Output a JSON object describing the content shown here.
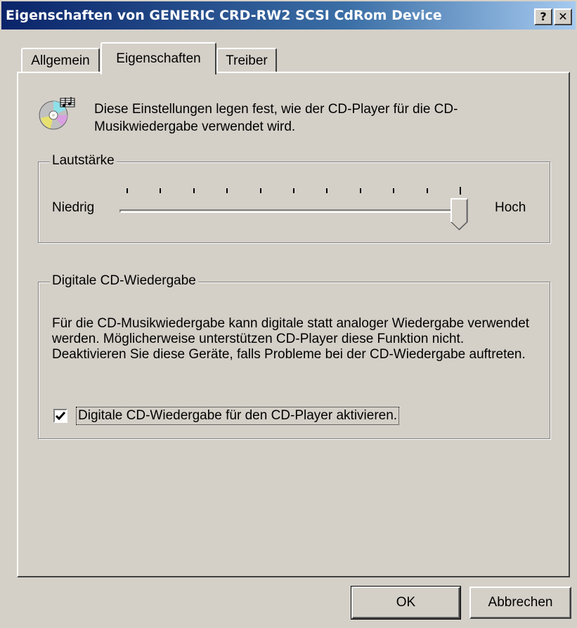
{
  "window": {
    "title": "Eigenschaften von GENERIC CRD-RW2 SCSI CdRom Device",
    "help_label": "?",
    "close_label": "✕"
  },
  "tabs": [
    {
      "label": "Allgemein",
      "selected": false
    },
    {
      "label": "Eigenschaften",
      "selected": true
    },
    {
      "label": "Treiber",
      "selected": false
    }
  ],
  "intro_text": "Diese Einstellungen legen fest, wie der CD-Player für die CD-Musikwiedergabe verwendet wird.",
  "volume": {
    "group_label": "Lautstärke",
    "low_label": "Niedrig",
    "high_label": "Hoch",
    "level_fraction": 1.0
  },
  "digital": {
    "group_label": "Digitale CD-Wiedergabe",
    "description": "Für die CD-Musikwiedergabe kann digitale statt analoger Wiedergabe verwendet werden. Möglicherweise unterstützen CD-Player diese Funktion nicht. Deaktivieren Sie diese Geräte, falls Probleme bei der CD-Wiedergabe auftreten.",
    "checkbox_label": "Digitale CD-Wiedergabe für den CD-Player aktivieren.",
    "checked": true
  },
  "buttons": {
    "ok": "OK",
    "cancel": "Abbrechen"
  },
  "icons": {
    "cd": "cd-music-icon",
    "check": "checkmark-icon"
  },
  "colors": {
    "titlebar_start": "#0a246a",
    "titlebar_end": "#a6caf0",
    "face": "#d4d0c8"
  }
}
